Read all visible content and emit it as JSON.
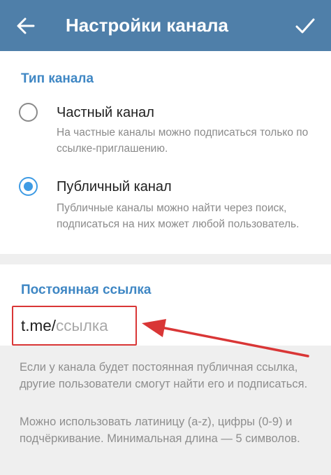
{
  "header": {
    "back_icon": "arrow-left-icon",
    "title": "Настройки канала",
    "done_icon": "check-icon"
  },
  "channel_type": {
    "section_title": "Тип канала",
    "options": [
      {
        "label": "Частный канал",
        "description": "На частные каналы можно подписаться только по ссылке-приглашению.",
        "selected": false
      },
      {
        "label": "Публичный канал",
        "description": "Публичные каналы можно найти через поиск, подписаться на них может любой пользователь.",
        "selected": true
      }
    ]
  },
  "permanent_link": {
    "section_title": "Постоянная ссылка",
    "prefix": "t.me/",
    "placeholder": "ссылка"
  },
  "help": {
    "paragraph1": "Если у канала будет постоянная публичная ссылка, другие пользователи смогут найти его и подписаться.",
    "paragraph2": "Можно использовать латиницу (a-z), цифры (0-9) и подчёркивание. Минимальная длина — 5 символов."
  },
  "colors": {
    "appbar": "#4f7fa9",
    "accent": "#3e9be4",
    "annotation": "#d93636"
  }
}
